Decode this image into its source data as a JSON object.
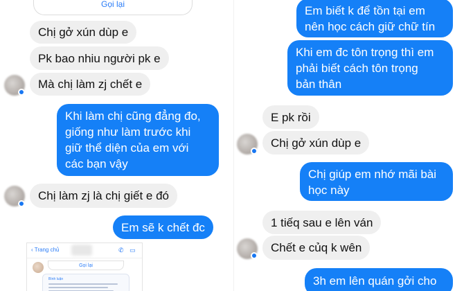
{
  "left": {
    "call_again_label": "Gọi lại",
    "messages": [
      {
        "side": "in",
        "text": "Chị gở xún dùp e"
      },
      {
        "side": "in",
        "text": "Pk bao nhiu người pk e"
      },
      {
        "side": "in",
        "text": "Mà chị làm zj chết e"
      },
      {
        "side": "out",
        "lines": [
          "Khi làm chị cũng đẳng đo,",
          "giống như làm trước khi",
          "giữ thể diện của em với",
          "các bạn vậy"
        ]
      },
      {
        "side": "in",
        "text": "Chị làm zj là chị giết e đó"
      },
      {
        "side": "out",
        "text": "Em sẽ k chết đc"
      }
    ],
    "embedded_screenshot": {
      "back_label": "Trang chủ",
      "call_again_label": "Gọi lại",
      "card_header": "Bình luận"
    }
  },
  "right": {
    "messages": [
      {
        "side": "out",
        "lines": [
          "Em biết k để tồn tại em",
          "nên học cách giữ chữ tín"
        ]
      },
      {
        "side": "out",
        "lines": [
          "Khi em đc tôn trọng thì em",
          "phải biết cách tôn trọng",
          "bản thân"
        ]
      },
      {
        "side": "in",
        "text": "E pk rồi"
      },
      {
        "side": "in",
        "text": "Chị gở xún dùp e"
      },
      {
        "side": "out",
        "lines": [
          "Chị giúp em nhớ mãi bài",
          "học này"
        ]
      },
      {
        "side": "in",
        "text": "1 tiếq sau e lên ván"
      },
      {
        "side": "in",
        "text": "Chết e củq k wên"
      },
      {
        "side": "out",
        "text": "3h em lên quán gởi cho"
      }
    ]
  },
  "colors": {
    "outgoing_bubble": "#1580f7",
    "incoming_bubble": "#efefef",
    "badge": "#1877f2",
    "link": "#2a7cf7"
  },
  "icons": [
    "back-chevron-icon",
    "phone-icon",
    "video-call-icon",
    "messenger-badge-icon"
  ]
}
